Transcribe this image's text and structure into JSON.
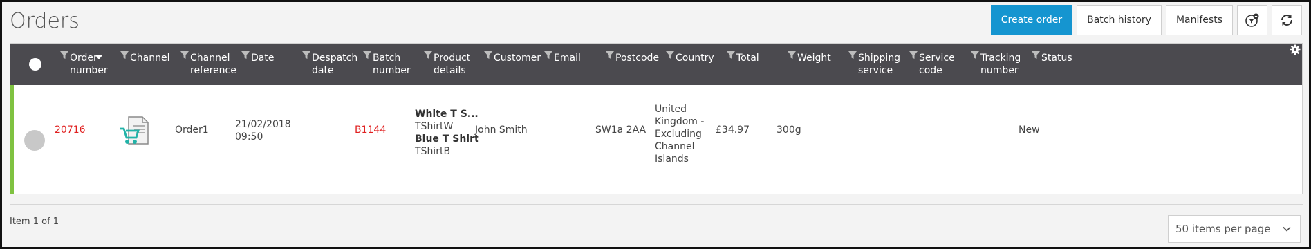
{
  "page": {
    "title": "Orders"
  },
  "toolbar": {
    "create_order": "Create order",
    "batch_history": "Batch history",
    "manifests": "Manifests",
    "filter_settings_icon": "filter-settings-icon",
    "refresh_icon": "refresh-icon"
  },
  "grid": {
    "columns": [
      {
        "label": "Order number",
        "lines": [
          "Order",
          "number"
        ]
      },
      {
        "label": "Channel",
        "lines": [
          "Channel"
        ]
      },
      {
        "label": "Channel reference",
        "lines": [
          "Channel",
          "reference"
        ]
      },
      {
        "label": "Date",
        "lines": [
          "Date"
        ]
      },
      {
        "label": "Despatch date",
        "lines": [
          "Despatch",
          "date"
        ]
      },
      {
        "label": "Batch number",
        "lines": [
          "Batch",
          "number"
        ]
      },
      {
        "label": "Product details",
        "lines": [
          "Product",
          "details"
        ]
      },
      {
        "label": "Customer",
        "lines": [
          "Customer"
        ]
      },
      {
        "label": "Email",
        "lines": [
          "Email"
        ]
      },
      {
        "label": "Postcode",
        "lines": [
          "Postcode"
        ]
      },
      {
        "label": "Country",
        "lines": [
          "Country"
        ]
      },
      {
        "label": "Total",
        "lines": [
          "Total"
        ]
      },
      {
        "label": "Weight",
        "lines": [
          "Weight"
        ]
      },
      {
        "label": "Shipping service",
        "lines": [
          "Shipping",
          "service"
        ]
      },
      {
        "label": "Service code",
        "lines": [
          "Service",
          "code"
        ]
      },
      {
        "label": "Tracking number",
        "lines": [
          "Tracking",
          "number"
        ]
      },
      {
        "label": "Status",
        "lines": [
          "Status"
        ]
      }
    ],
    "rows": [
      {
        "order_number": "20716",
        "channel_icon": "shopping-cart-document-icon",
        "channel_reference": "Order1",
        "date_line1": "21/02/2018",
        "date_line2": "09:50",
        "despatch_date": "",
        "batch_number": "B1144",
        "products": [
          {
            "name": "White T S...",
            "sku": "TShirtW"
          },
          {
            "name": "Blue T Shirt",
            "sku": "TShirtB"
          }
        ],
        "customer": "John Smith",
        "email": "",
        "postcode": "SW1a 2AA",
        "country_lines": [
          "United",
          "Kingdom -",
          "Excluding",
          "Channel",
          "Islands"
        ],
        "total": "£34.97",
        "weight": "300g",
        "shipping_service": "",
        "service_code": "",
        "tracking_number": "",
        "status": "New"
      }
    ]
  },
  "pager": {
    "summary": "Item 1 of 1",
    "page_size": "50 items per page"
  },
  "colors": {
    "accent": "#1595d0",
    "header_bg": "#4b4a4f",
    "row_marker": "#7fc241",
    "link_red": "#e02020"
  }
}
